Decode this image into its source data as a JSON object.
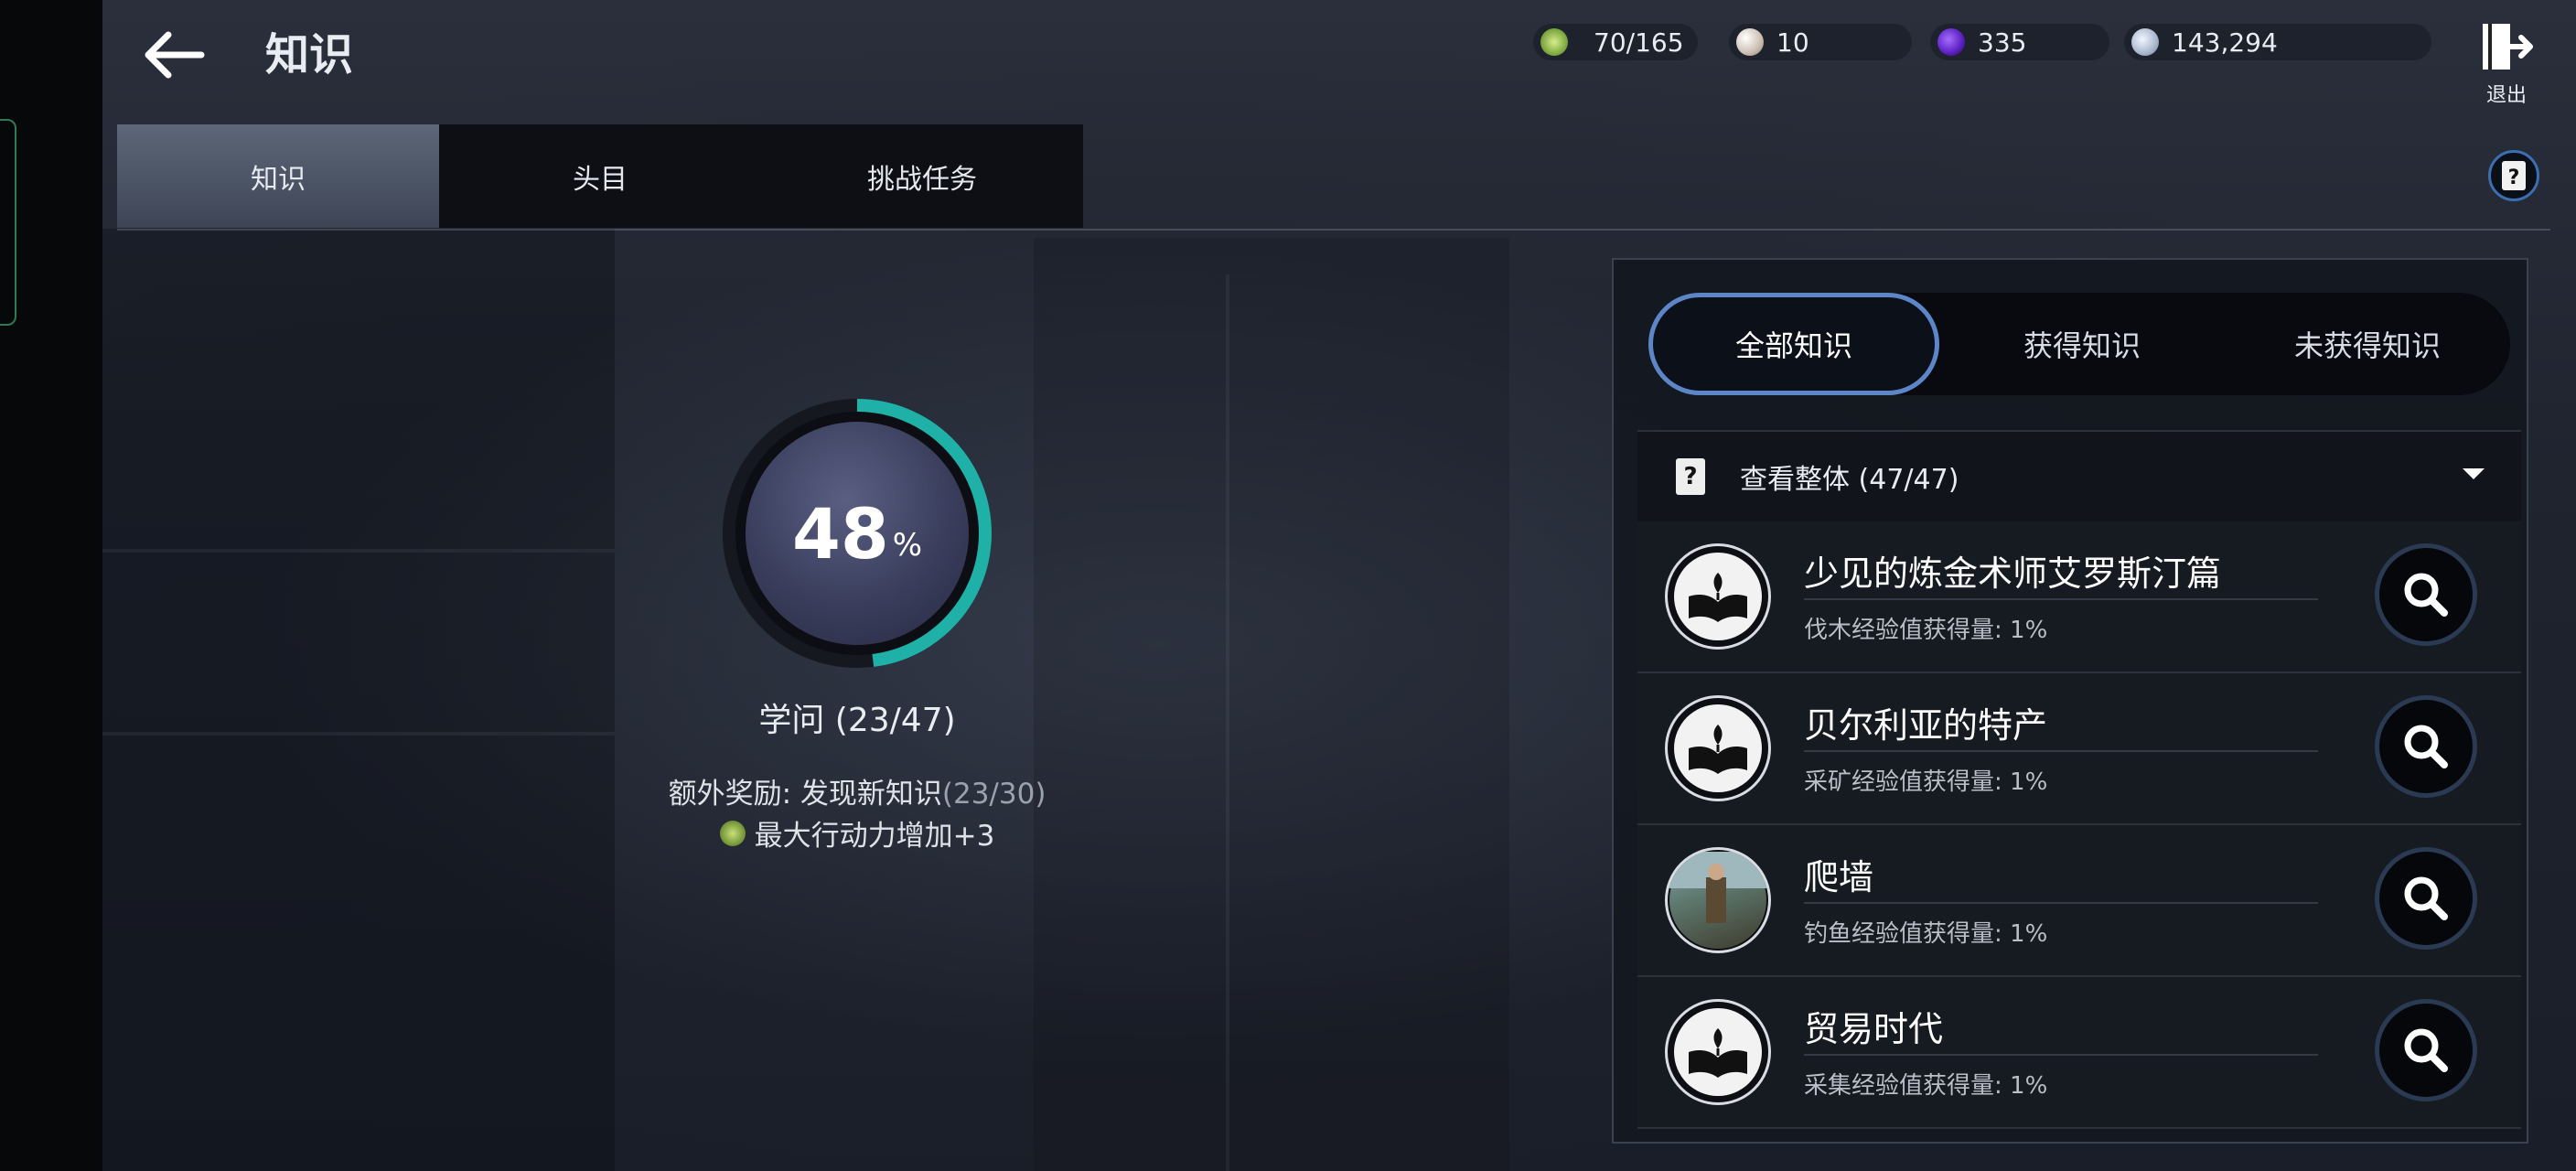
{
  "header": {
    "title": "知识",
    "back_icon": "arrow-left-icon",
    "resources": [
      {
        "icon": "energy-icon",
        "value": "70/165",
        "color": "#9fd05b"
      },
      {
        "icon": "pearl-icon",
        "value": "10",
        "color": "#d8d0c8"
      },
      {
        "icon": "purple-orb-icon",
        "value": "335",
        "color": "#6b2bd6"
      },
      {
        "icon": "silver-coin-icon",
        "value": "143,294",
        "color": "#c6d2e2"
      }
    ],
    "exit_label": "退出"
  },
  "tabs": [
    {
      "label": "知识",
      "active": true
    },
    {
      "label": "头目",
      "active": false
    },
    {
      "label": "挑战任务",
      "active": false
    }
  ],
  "progress": {
    "percent": "48",
    "percent_sign": "%",
    "fraction": 0.48,
    "label": "学问 (23/47)",
    "bonus_label": "额外奖励: 发现新知识",
    "bonus_count": "(23/30)",
    "bonus_reward": "最大行动力增加+3",
    "ring_color": "#1fb0a8"
  },
  "filter": {
    "options": [
      {
        "label": "全部知识",
        "active": true
      },
      {
        "label": "获得知识",
        "active": false
      },
      {
        "label": "未获得知识",
        "active": false
      }
    ]
  },
  "dropdown": {
    "icon_glyph": "?",
    "label": "查看整体 (47/47)"
  },
  "items": [
    {
      "title": "少见的炼金术师艾罗斯汀篇",
      "subtitle": "伐木经验值获得量: 1%",
      "icon": "book-feather-icon"
    },
    {
      "title": "贝尔利亚的特产",
      "subtitle": "采矿经验值获得量: 1%",
      "icon": "book-feather-icon"
    },
    {
      "title": "爬墙",
      "subtitle": "钓鱼经验值获得量: 1%",
      "icon": "climbing-photo-icon"
    },
    {
      "title": "贸易时代",
      "subtitle": "采集经验值获得量: 1%",
      "icon": "book-feather-icon"
    }
  ]
}
